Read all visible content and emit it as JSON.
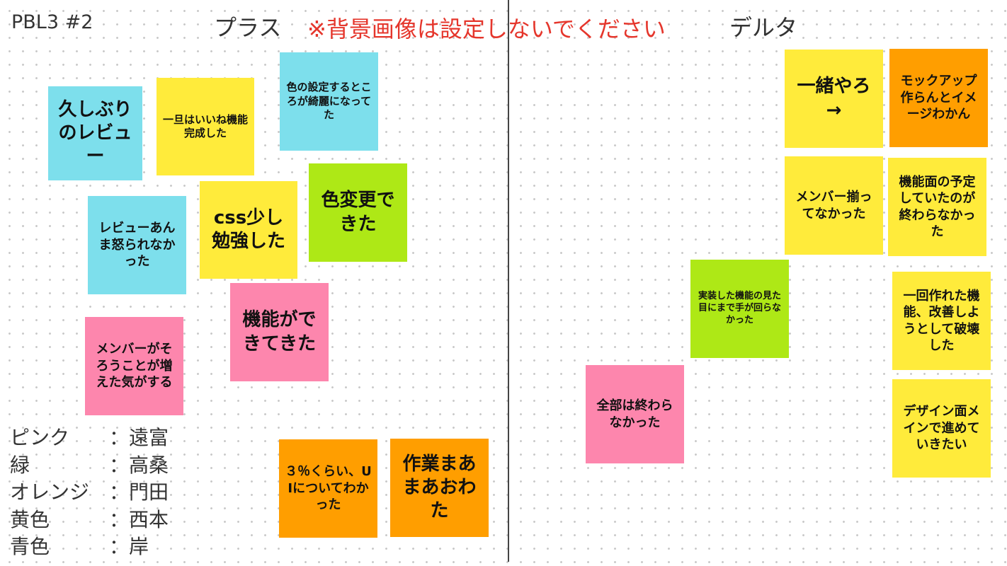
{
  "board": {
    "title": "PBL3 #2",
    "plus_label": "プラス",
    "warning": "※背景画像は設定しないでください",
    "delta_label": "デルタ"
  },
  "notes": {
    "n1": "久しぶりのレビュー",
    "n2": "一旦はいいね機能完成した",
    "n3": "色の設定するところが綺麗になってた",
    "n4": "css少し勉強した",
    "n5": "色変更できた",
    "n6": "レビューあんま怒られなかった",
    "n7": "機能ができてきた",
    "n8": "メンバーがそろうことが増えた気がする",
    "n9": "３％くらい、UIについてわかった",
    "n10": "作業まあまあおわた",
    "d1": "一緒やろ→",
    "d2": "モックアップ作らんとイメージわかん",
    "d3": "メンバー揃ってなかった",
    "d4": "機能面の予定していたのが終わらなかった",
    "d5": "実装した機能の見た目にまで手が回らなかった",
    "d6": "一回作れた機能、改善しようとして破壊した",
    "d7": "全部は終わらなかった",
    "d8": "デザイン面メインで進めていきたい"
  },
  "legend": [
    {
      "color": "ピンク",
      "name": "：遠富"
    },
    {
      "color": "緑",
      "name": "：高桑"
    },
    {
      "color": "オレンジ",
      "name": "：門田"
    },
    {
      "color": "黄色",
      "name": "：西本"
    },
    {
      "color": "青色",
      "name": "：岸"
    }
  ],
  "colors": {
    "yellow": "#ffeb3b",
    "blue": "#7ddfec",
    "green": "#aee816",
    "pink": "#fd86ad",
    "orange": "#ff9e00",
    "warning": "#e5362c"
  }
}
